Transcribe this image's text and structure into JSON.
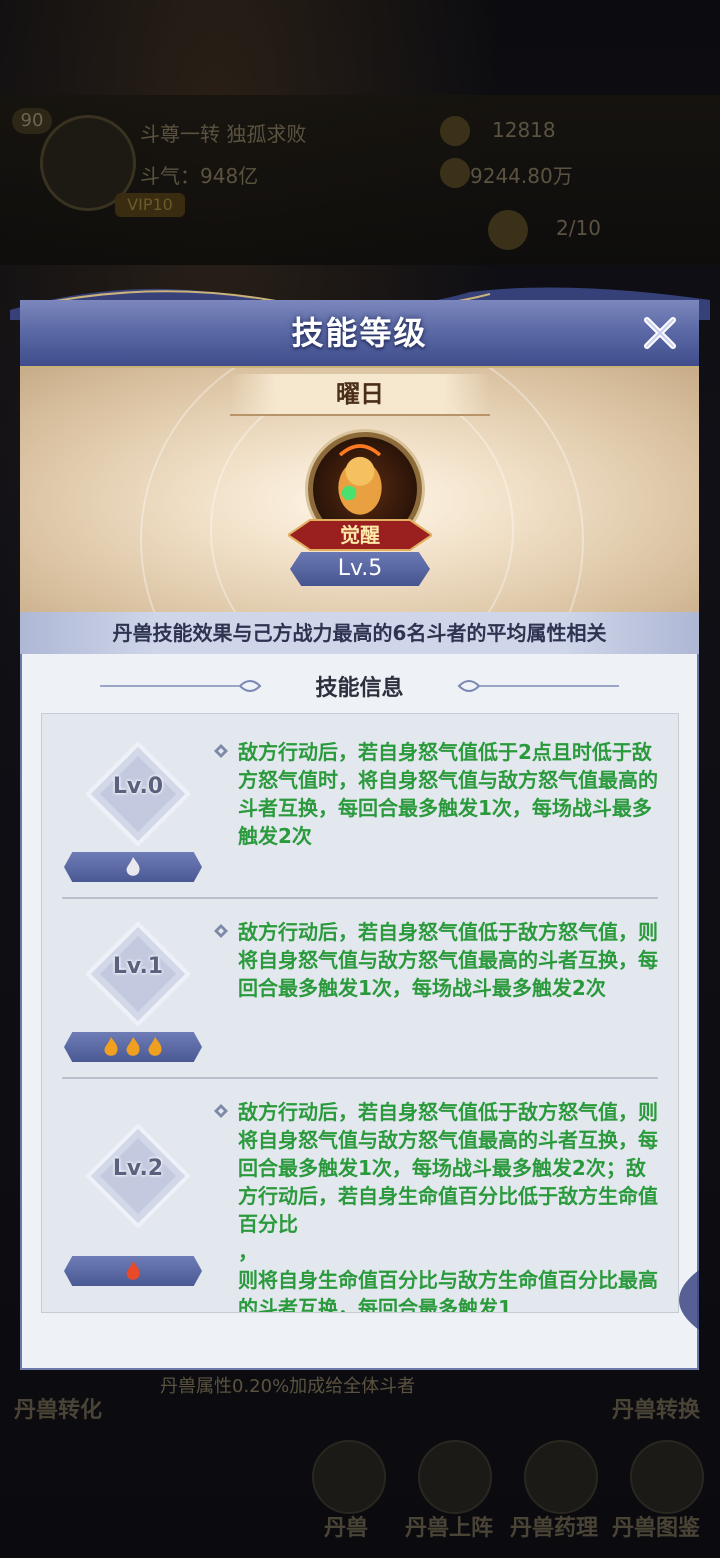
{
  "background": {
    "level": "90",
    "player_name": "斗尊一转 独孤求败",
    "power": "斗气：948亿",
    "vip": "VIP10",
    "currency1": "12818",
    "currency2": "9244.80万",
    "counter": "2/10",
    "bottom_hint": "丹兽属性0.20%加成给全体斗者",
    "left_label": "丹兽转化",
    "right_label": "丹兽转换",
    "nav": [
      "丹兽",
      "丹兽上阵",
      "丹兽药理",
      "丹兽图鉴"
    ]
  },
  "dialog": {
    "title": "技能等级",
    "skill_name": "曜日",
    "awaken_label": "觉醒",
    "level_label": "Lv.5",
    "description": "丹兽技能效果与己方战力最高的6名斗者的平均属性相关",
    "section_title": "技能信息",
    "levels": [
      {
        "label": "Lv.0",
        "flames": 1,
        "flame_color": "#e8e8ee",
        "text": "敌方行动后，若自身怒气值低于2点且时低于敌方怒气值时，将自身怒气值与敌方怒气值最高的斗者互换，每回合最多触发1次，每场战斗最多触发2次"
      },
      {
        "label": "Lv.1",
        "flames": 3,
        "flame_color": "#f0a020",
        "text": "敌方行动后，若自身怒气值低于敌方怒气值，则将自身怒气值与敌方怒气值最高的斗者互换，每回合最多触发1次，每场战斗最多触发2次"
      },
      {
        "label": "Lv.2",
        "flames": 1,
        "flame_color": "#e84a2a",
        "text": "敌方行动后，若自身怒气值低于敌方怒气值，则将自身怒气值与敌方怒气值最高的斗者互换，每回合最多触发1次，每场战斗最多触发2次；敌方行动后，若自身生命值百分比低于敌方生命值百分比\n，\n则将自身生命值百分比与敌方生命值百分比最高的斗者互换，每回合最多触发1"
      }
    ]
  },
  "colors": {
    "header": "#5c6aa6",
    "skill_text": "#2a9a3c",
    "panel": "#e3e7ee"
  }
}
